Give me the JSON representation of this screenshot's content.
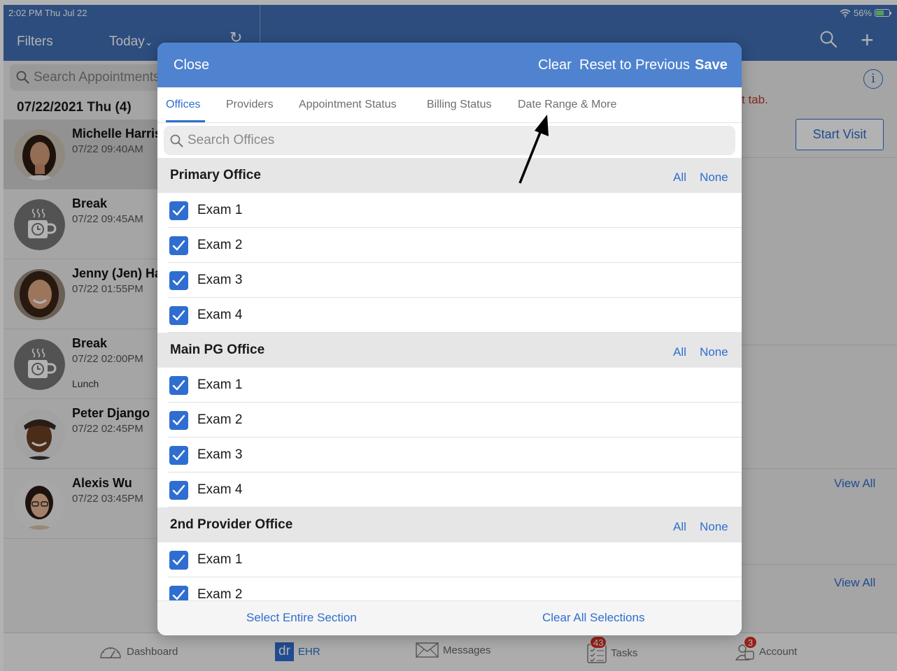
{
  "status_bar": {
    "time": "2:02 PM  Thu Jul 22",
    "battery": "56%"
  },
  "navbar": {
    "filters": "Filters",
    "today": "Today",
    "chevron": "⌄",
    "refresh": "↻",
    "plus": "+"
  },
  "left": {
    "search_placeholder": "Search Appointments",
    "day_header": "07/22/2021 Thu (4)",
    "appointments": [
      {
        "name": "Michelle Harris",
        "time": "07/22 09:40AM",
        "note": ""
      },
      {
        "name": "Break",
        "time": "07/22 09:45AM",
        "note": ""
      },
      {
        "name": "Jenny (Jen) Harris",
        "time": "07/22 01:55PM",
        "note": ""
      },
      {
        "name": "Break",
        "time": "07/22 02:00PM",
        "note": "Lunch"
      },
      {
        "name": "Peter Django",
        "time": "07/22 02:45PM",
        "note": ""
      },
      {
        "name": "Alexis Wu",
        "time": "07/22 03:45PM",
        "note": ""
      }
    ]
  },
  "right": {
    "info": "i",
    "hint": "t tab.",
    "start_visit": "Start Visit",
    "view_all_1": "View All",
    "view_all_2": "View All"
  },
  "modal": {
    "close": "Close",
    "clear": "Clear",
    "reset": "Reset to Previous",
    "save": "Save",
    "tabs": [
      "Offices",
      "Providers",
      "Appointment Status",
      "Billing Status",
      "Date Range & More"
    ],
    "search_placeholder": "Search Offices",
    "all": "All",
    "none": "None",
    "sections": [
      {
        "title": "Primary Office",
        "items": [
          "Exam 1",
          "Exam 2",
          "Exam 3",
          "Exam 4"
        ]
      },
      {
        "title": "Main PG Office",
        "items": [
          "Exam 1",
          "Exam 2",
          "Exam 3",
          "Exam 4"
        ]
      },
      {
        "title": "2nd Provider Office",
        "items": [
          "Exam 1",
          "Exam 2"
        ]
      }
    ],
    "footer": {
      "select_section": "Select Entire Section",
      "clear_all": "Clear All Selections"
    }
  },
  "bottom_tabs": {
    "dashboard": "Dashboard",
    "ehr_logo": "dr",
    "ehr": "EHR",
    "messages": "Messages",
    "tasks": "Tasks",
    "tasks_badge": "43",
    "account": "Account",
    "account_badge": "3"
  },
  "colors": {
    "brand": "#3f6fb5",
    "modal_header": "#4f83cf",
    "accent": "#2f6ed0",
    "badge": "#d93025"
  }
}
